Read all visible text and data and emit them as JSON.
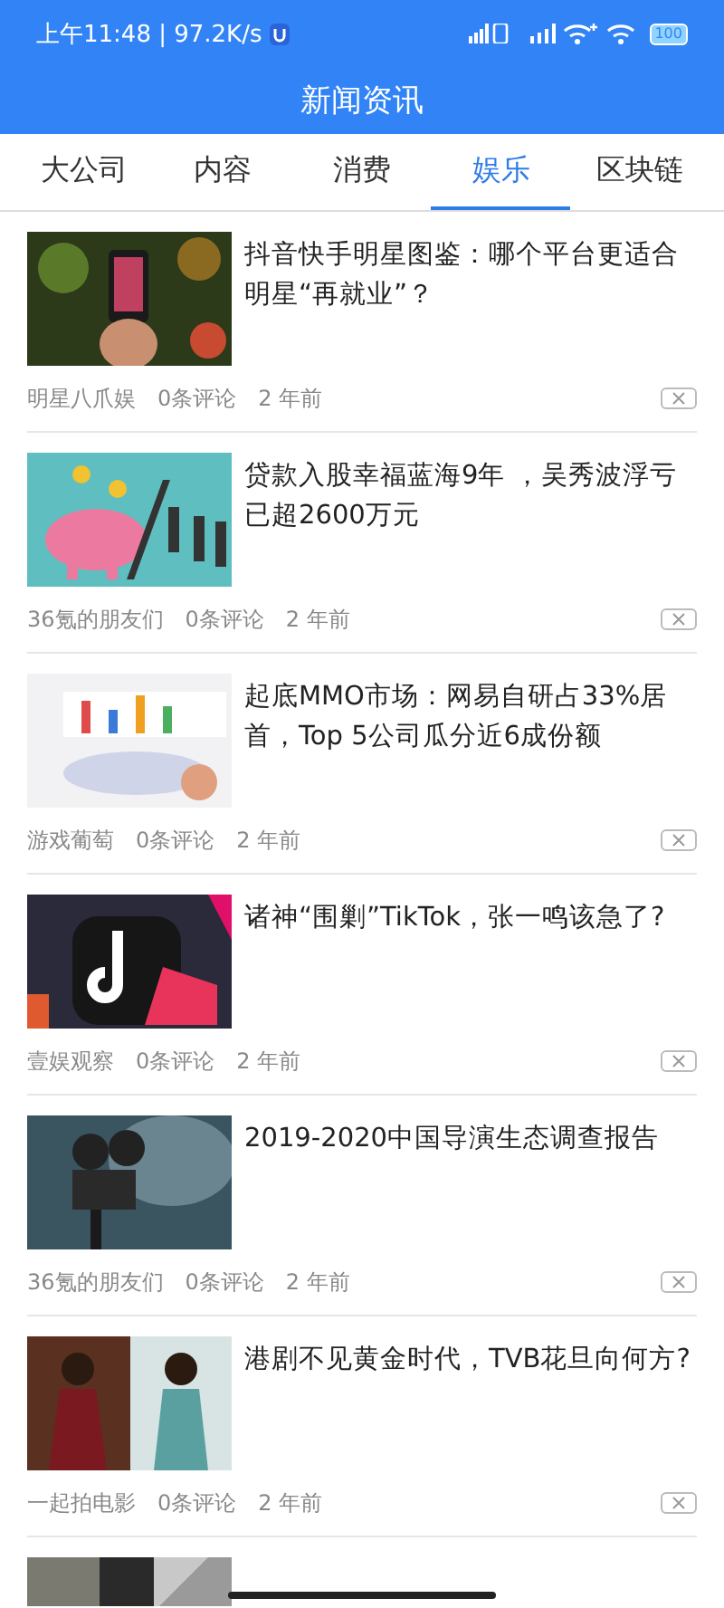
{
  "status_bar": {
    "time": "上午11:48 | 97.2K/s",
    "battery": "100"
  },
  "header": {
    "title": "新闻资讯"
  },
  "tabs": [
    {
      "label": "大公司",
      "selected": false
    },
    {
      "label": "内容",
      "selected": false
    },
    {
      "label": "消费",
      "selected": false
    },
    {
      "label": "娱乐",
      "selected": true
    },
    {
      "label": "区块链",
      "selected": false
    }
  ],
  "articles": [
    {
      "title": "抖音快手明星图鉴：哪个平台更适合明星“再就业”？",
      "source": "明星八爪娱",
      "comments": "0条评论",
      "time": "2 年前"
    },
    {
      "title": "贷款入股幸福蓝海9年 ，吴秀波浮亏已超2600万元",
      "source": "36氪的朋友们",
      "comments": "0条评论",
      "time": "2 年前"
    },
    {
      "title": "起底MMO市场：网易自研占33%居首，Top 5公司瓜分近6成份额",
      "source": "游戏葡萄",
      "comments": "0条评论",
      "time": "2 年前"
    },
    {
      "title": "诸神“围剿”TikTok，张一鸣该急了?",
      "source": "壹娱观察",
      "comments": "0条评论",
      "time": "2 年前"
    },
    {
      "title": "2019-2020中国导演生态调查报告",
      "source": "36氪的朋友们",
      "comments": "0条评论",
      "time": "2 年前"
    },
    {
      "title": "港剧不见黄金时代，TVB花旦向何方?",
      "source": "一起拍电影",
      "comments": "0条评论",
      "time": "2 年前"
    }
  ]
}
